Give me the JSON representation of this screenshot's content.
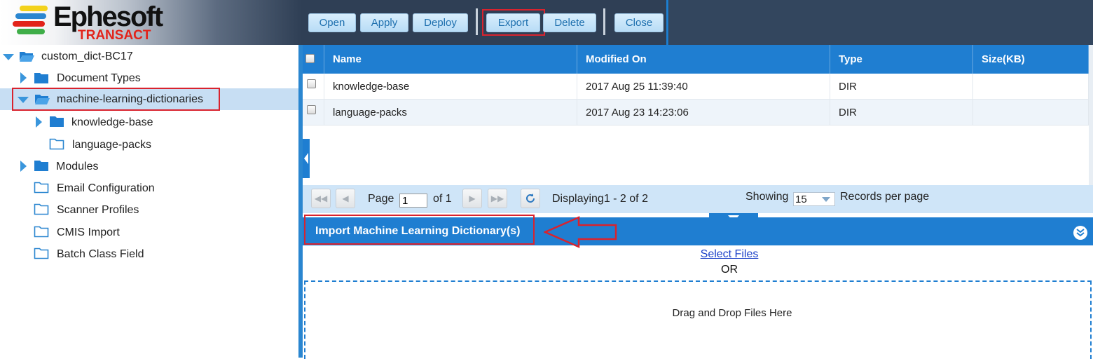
{
  "app": {
    "logo_name": "Ephesoft",
    "logo_sub": "TRANSACT",
    "colors": {
      "header_bg": "#2f3f55",
      "accent": "#1f7ed1",
      "highlight_red": "#d9232e"
    }
  },
  "toolbar": {
    "open_label": "Open",
    "apply_label": "Apply",
    "deploy_label": "Deploy",
    "export_label": "Export",
    "delete_label": "Delete",
    "close_label": "Close"
  },
  "tree": {
    "root": {
      "label": "custom_dict-BC17",
      "icon": "folder-open-icon"
    },
    "items": [
      {
        "label": "Document Types",
        "icon": "folder-icon"
      },
      {
        "label": "machine-learning-dictionaries",
        "icon": "folder-open-icon",
        "selected": true
      },
      {
        "label": "knowledge-base",
        "icon": "folder-icon"
      },
      {
        "label": "language-packs",
        "icon": "folder-outline-icon"
      },
      {
        "label": "Modules",
        "icon": "folder-icon"
      },
      {
        "label": "Email Configuration",
        "icon": "folder-outline-icon"
      },
      {
        "label": "Scanner Profiles",
        "icon": "folder-outline-icon"
      },
      {
        "label": "CMIS Import",
        "icon": "folder-outline-icon"
      },
      {
        "label": "Batch Class Field",
        "icon": "folder-outline-icon"
      }
    ]
  },
  "grid": {
    "columns": [
      "Name",
      "Modified On",
      "Type",
      "Size(KB)"
    ],
    "rows": [
      {
        "name": "knowledge-base",
        "modified": "2017 Aug 25 11:39:40",
        "type": "DIR",
        "size": ""
      },
      {
        "name": "language-packs",
        "modified": "2017 Aug 23 14:23:06",
        "type": "DIR",
        "size": ""
      }
    ]
  },
  "pager": {
    "page_label": "Page",
    "page_value": "1",
    "of_label": "of 1",
    "displaying": "Displaying1 - 2 of 2",
    "showing_label": "Showing",
    "page_size": "15",
    "records_label": "Records per page"
  },
  "import": {
    "title": "Import Machine Learning Dictionary(s)",
    "select_files": "Select Files",
    "or": "OR",
    "drop_text": "Drag and Drop Files Here"
  }
}
